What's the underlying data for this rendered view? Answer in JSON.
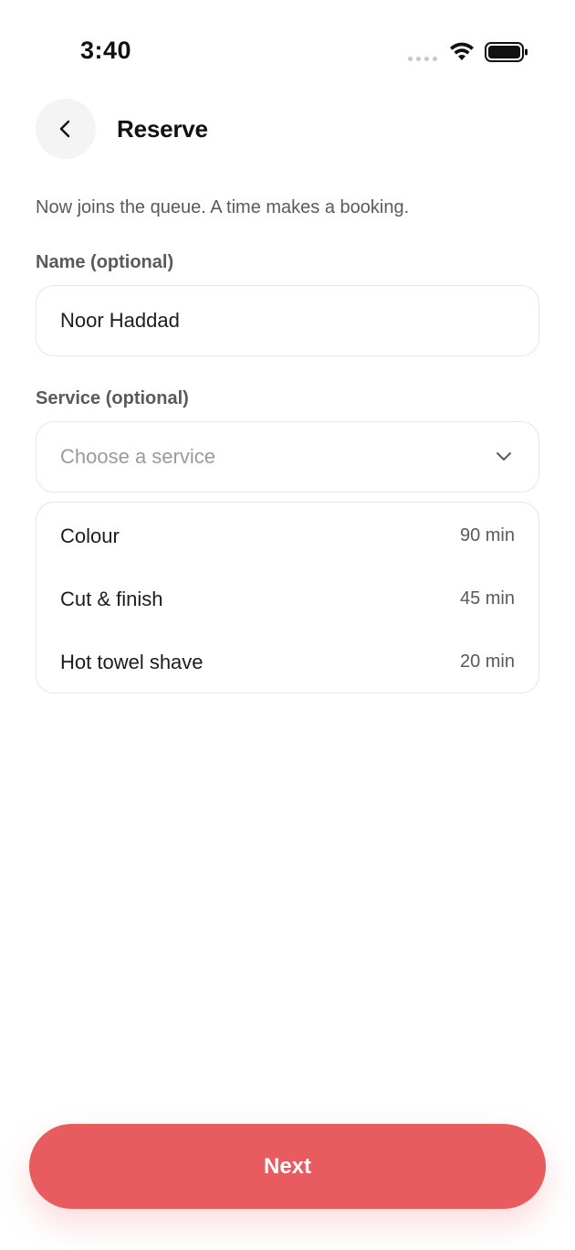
{
  "status_bar": {
    "time": "3:40"
  },
  "header": {
    "title": "Reserve"
  },
  "subtitle": "Now joins the queue. A time makes a booking.",
  "name_field": {
    "label": "Name (optional)",
    "value": "Noor Haddad"
  },
  "service_field": {
    "label": "Service (optional)",
    "placeholder": "Choose a service"
  },
  "services": [
    {
      "name": "Colour",
      "duration": "90 min"
    },
    {
      "name": "Cut & finish",
      "duration": "45 min"
    },
    {
      "name": "Hot towel shave",
      "duration": "20 min"
    }
  ],
  "next_button": {
    "label": "Next"
  },
  "colors": {
    "accent": "#e85b5e",
    "muted_text": "#5a5a5e",
    "border": "#e6e6e9"
  }
}
